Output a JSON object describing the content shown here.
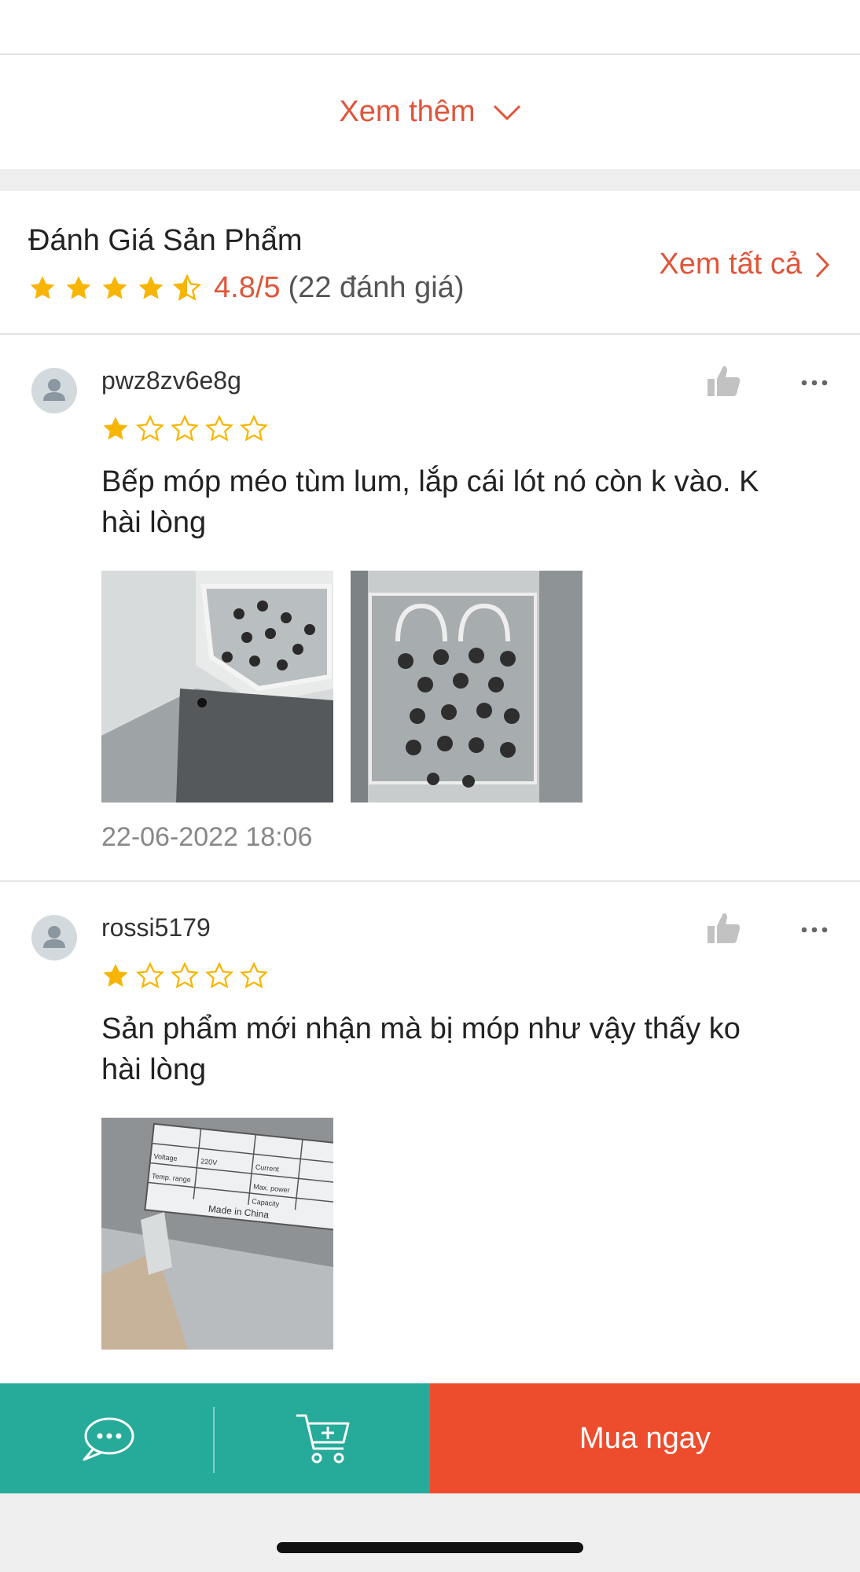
{
  "see_more": {
    "label": "Xem thêm"
  },
  "ratings": {
    "title": "Đánh Giá Sản Phẩm",
    "average": "4.8/5",
    "count": "(22 đánh giá)",
    "see_all": "Xem tất cả",
    "stars_value": 4.5
  },
  "reviews": [
    {
      "username": "pwz8zv6e8g",
      "stars": 1,
      "text_line1": "Bếp móp méo tùm lum, lắp cái lót nó còn k vào. K",
      "text_line2": "hài lòng",
      "date": "22-06-2022 18:06"
    },
    {
      "username": "rossi5179",
      "stars": 1,
      "text_line1": "Sản phẩm mới nhận mà bị móp như vậy thấy ko",
      "text_line2": "hài lòng",
      "label_plate": {
        "cells": [
          "Voltage",
          "220V",
          "Current",
          "Temp. range",
          "Max. power",
          "Capacity"
        ],
        "made_in": "Made in China"
      }
    }
  ],
  "bottom_bar": {
    "buy_now": "Mua ngay",
    "chat_icon": "chat-icon",
    "cart_icon": "add-to-cart-icon"
  },
  "colors": {
    "accent": "#ee4d2d",
    "link": "#e0553a",
    "teal": "#26aa99",
    "star": "#f7b500"
  }
}
